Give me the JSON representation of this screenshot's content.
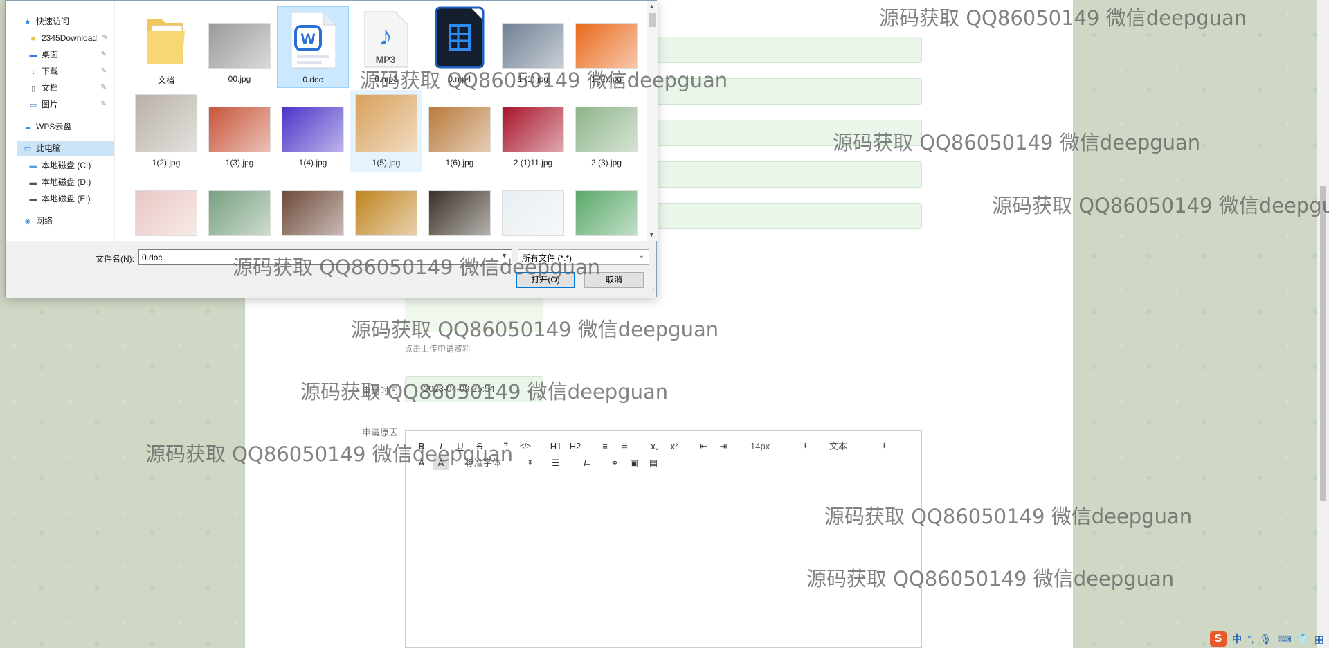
{
  "page": {
    "upload_hint": "点击上传申请资料",
    "apply_time_label": "申请时间",
    "apply_time_value": "2023-04-09 25:54",
    "reason_label": "申请原因",
    "editor": {
      "buttons": [
        "B",
        "I",
        "U",
        "S",
        "❞",
        "</>",
        "H1",
        "H2",
        "≡",
        "≣",
        "x₂",
        "x²",
        "⇤",
        "⇥"
      ],
      "font_size": "14px",
      "block_type": "文本",
      "font_family": "标准字体"
    }
  },
  "dialog": {
    "nav": {
      "quick_access": "快速访问",
      "quick_items": [
        "2345Download",
        "桌面",
        "下载",
        "文档",
        "图片"
      ],
      "wps_cloud": "WPS云盘",
      "this_pc": "此电脑",
      "drives": [
        "本地磁盘 (C:)",
        "本地磁盘 (D:)",
        "本地磁盘 (E:)"
      ],
      "network": "网络"
    },
    "files": [
      {
        "name": "文档",
        "kind": "folder"
      },
      {
        "name": "00.jpg",
        "kind": "photo",
        "color": "#9a9a9a"
      },
      {
        "name": "0.doc",
        "kind": "doc",
        "selected": true
      },
      {
        "name": "0.mp3",
        "kind": "mp3"
      },
      {
        "name": "0.mp4",
        "kind": "mp4"
      },
      {
        "name": "1 (1).jpg",
        "kind": "photo",
        "color": "#6f7f93"
      },
      {
        "name": "1 (2).jpg",
        "kind": "photo",
        "color": "#e96a1c"
      },
      {
        "name": "1(2).jpg",
        "kind": "photo",
        "color": "#b7b0a6"
      },
      {
        "name": "1(3).jpg",
        "kind": "photo",
        "color": "#c7563a"
      },
      {
        "name": "1(4).jpg",
        "kind": "photo",
        "color": "#4b35c8"
      },
      {
        "name": "1(5).jpg",
        "kind": "photo",
        "color": "#d8a05a",
        "hover": true
      },
      {
        "name": "1(6).jpg",
        "kind": "photo",
        "color": "#b97a3c"
      },
      {
        "name": "2 (1)11.jpg",
        "kind": "photo",
        "color": "#a8142a"
      },
      {
        "name": "2 (3).jpg",
        "kind": "photo",
        "color": "#8fb48a"
      },
      {
        "name": "",
        "kind": "photo",
        "color": "#e9c7c4"
      },
      {
        "name": "",
        "kind": "photo",
        "color": "#79a080"
      },
      {
        "name": "",
        "kind": "photo",
        "color": "#6e4a3a"
      },
      {
        "name": "",
        "kind": "photo",
        "color": "#c08420"
      },
      {
        "name": "",
        "kind": "photo",
        "color": "#3b3128"
      },
      {
        "name": "",
        "kind": "photo",
        "color": "#e8eef2"
      },
      {
        "name": "",
        "kind": "photo",
        "color": "#5aa96a"
      }
    ],
    "filename_label": "文件名(N):",
    "filename_value": "0.doc",
    "filetype": "所有文件 (*.*)",
    "open_label": "打开(O)",
    "cancel_label": "取消"
  },
  "watermark_text": "源码获取 QQ86050149 微信deepguan",
  "ime": {
    "logo": "S",
    "lang": "中"
  }
}
